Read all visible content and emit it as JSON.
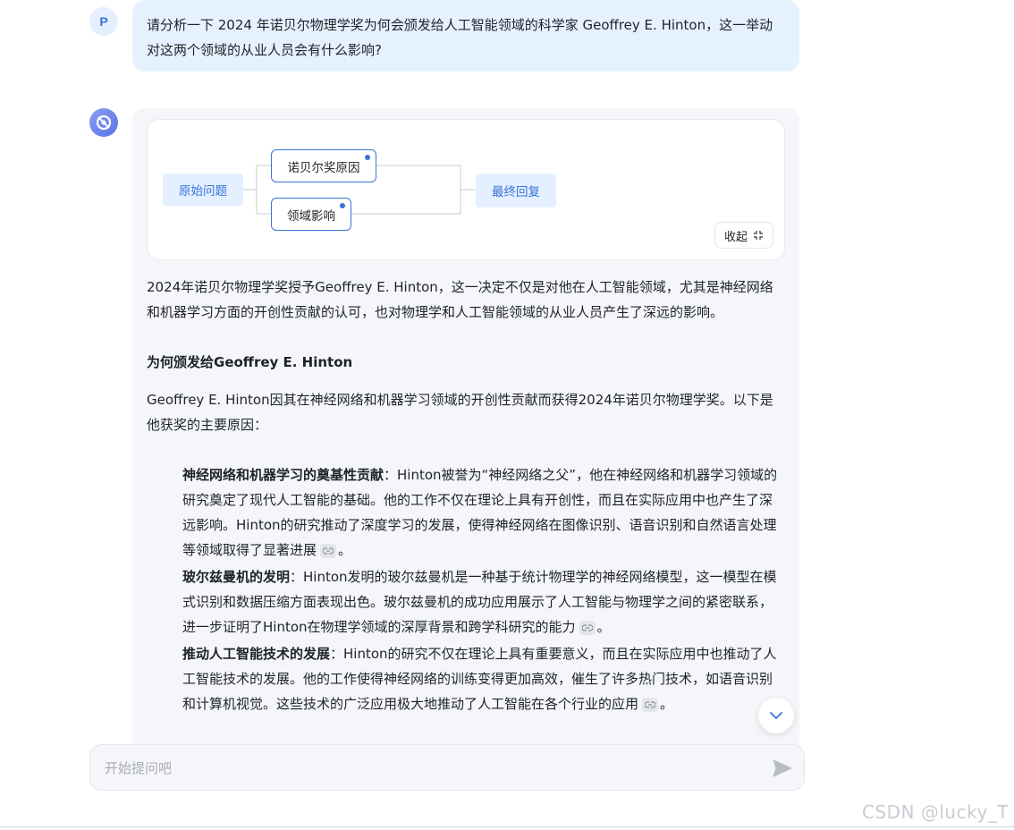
{
  "user": {
    "avatar_letter": "P",
    "question": "请分析一下 2024 年诺贝尔物理学奖为何会颁发给人工智能领域的科学家 Geoffrey E. Hinton，这一举动对这两个领域的从业人员会有什么影响?"
  },
  "mindmap": {
    "root": "原始问题",
    "children": [
      "诺贝尔奖原因",
      "领域影响"
    ],
    "final": "最终回复",
    "collapse_label": "收起",
    "collapse_icon": "collapse-icon"
  },
  "answer": {
    "intro": "2024年诺贝尔物理学奖授予Geoffrey E. Hinton，这一决定不仅是对他在人工智能领域，尤其是神经网络和机器学习方面的开创性贡献的认可，也对物理学和人工智能领域的从业人员产生了深远的影响。",
    "heading": "为何颁发给Geoffrey E. Hinton",
    "summary": "Geoffrey E. Hinton因其在神经网络和机器学习领域的开创性贡献而获得2024年诺贝尔物理学奖。以下是他获奖的主要原因：",
    "items": [
      {
        "title": "神经网络和机器学习的奠基性贡献",
        "text": "：Hinton被誉为“神经网络之父”，他在神经网络和机器学习领域的研究奠定了现代人工智能的基础。他的工作不仅在理论上具有开创性，而且在实际应用中也产生了深远影响。Hinton的研究推动了深度学习的发展，使得神经网络在图像识别、语音识别和自然语言处理等领域取得了显著进展",
        "end": "。"
      },
      {
        "title": "玻尔兹曼机的发明",
        "text": "：Hinton发明的玻尔兹曼机是一种基于统计物理学的神经网络模型，这一模型在模式识别和数据压缩方面表现出色。玻尔兹曼机的成功应用展示了人工智能与物理学之间的紧密联系，进一步证明了Hinton在物理学领域的深厚背景和跨学科研究的能力",
        "end": "。"
      },
      {
        "title": "推动人工智能技术的发展",
        "text": "：Hinton的研究不仅在理论上具有重要意义，而且在实际应用中也推动了人工智能技术的发展。他的工作使得神经网络的训练变得更加高效，催生了许多热门技术，如语音识别和计算机视觉。这些技术的广泛应用极大地推动了人工智能在各个行业的应用",
        "end": "。"
      }
    ]
  },
  "input": {
    "placeholder": "开始提问吧"
  },
  "watermark": "CSDN @lucky_T"
}
